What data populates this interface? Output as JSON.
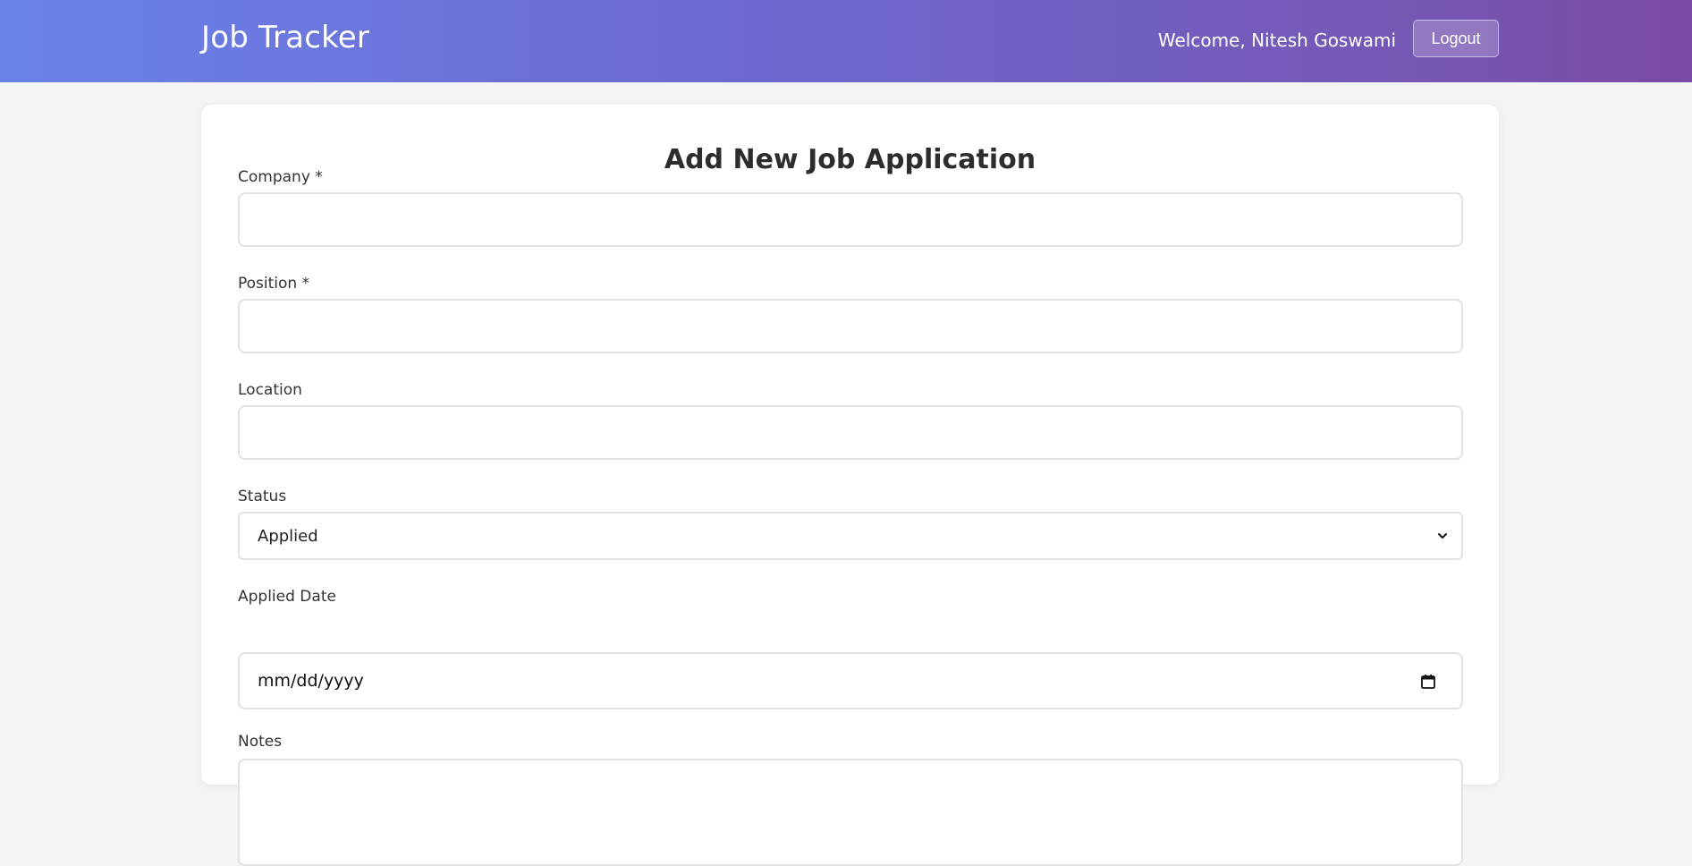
{
  "header": {
    "brand": "Job Tracker",
    "welcome": "Welcome, Nitesh Goswami",
    "logout_label": "Logout"
  },
  "form": {
    "title": "Add New Job Application",
    "company": {
      "label": "Company *",
      "value": "",
      "placeholder": ""
    },
    "position": {
      "label": "Position *",
      "value": "",
      "placeholder": ""
    },
    "location": {
      "label": "Location",
      "value": "",
      "placeholder": ""
    },
    "status": {
      "label": "Status",
      "selected": "Applied"
    },
    "applied_date": {
      "label": "Applied Date",
      "placeholder": "mm/dd/yyyy"
    },
    "notes": {
      "label": "Notes"
    }
  },
  "icons": {
    "status_dropdown": "chevron-down-icon",
    "date_picker": "calendar-icon"
  },
  "colors": {
    "header_gradient_start": "#6a82e8",
    "header_gradient_end": "#7b4aa5",
    "page_background": "#f3f4f6",
    "card_background": "#ffffff",
    "input_border": "#e2e2e2"
  }
}
